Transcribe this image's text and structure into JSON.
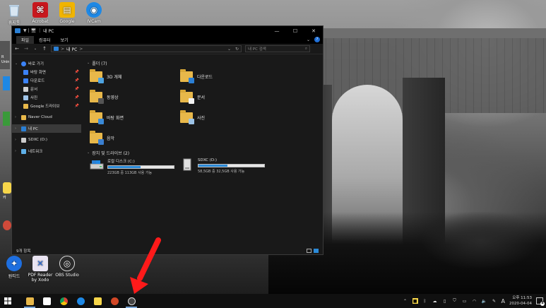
{
  "desktop": {
    "icons_top": [
      {
        "label": "휴지통",
        "icon": "recycle-bin-icon",
        "color": "#9ab7d4"
      },
      {
        "label": "Acrobat",
        "icon": "acrobat-icon",
        "color": "#c8171e"
      },
      {
        "label": "Google",
        "icon": "google-icon",
        "color": "#f0b400"
      },
      {
        "label": "IVCam",
        "icon": "ivcam-icon",
        "color": "#1e88e5"
      }
    ],
    "icons_bottom": [
      {
        "label": "원티드",
        "icon": "wanted-icon",
        "color": "#1e6fe0"
      },
      {
        "label": "PDF Reader by Xodo",
        "icon": "pdf-reader-icon",
        "color": "#e9e4f2"
      },
      {
        "label": "OBS Studio",
        "icon": "obs-icon",
        "color": "#2b2b2b"
      }
    ],
    "left_edge_fragments": [
      "R",
      "Unin",
      "카"
    ]
  },
  "window": {
    "title": "내 PC",
    "title_path_icon": "▼ | 🖥",
    "ribbon_tabs": [
      "파일",
      "컴퓨터",
      "보기"
    ],
    "address": "내 PC",
    "address_separator": ">",
    "search_placeholder": "내 PC 검색",
    "nav": [
      {
        "label": "바로 가기",
        "level": 0,
        "icon": "star-icon",
        "color": "#3b82f6"
      },
      {
        "label": "바탕 화면",
        "level": 1,
        "icon": "desktop-icon",
        "color": "#3b82f6",
        "pinned": true
      },
      {
        "label": "다운로드",
        "level": 1,
        "icon": "download-icon",
        "color": "#3b82f6",
        "pinned": true
      },
      {
        "label": "문서",
        "level": 1,
        "icon": "documents-icon",
        "color": "#d0d0d0",
        "pinned": true
      },
      {
        "label": "사진",
        "level": 1,
        "icon": "pictures-icon",
        "color": "#a0c4e8",
        "pinned": true
      },
      {
        "label": "Google 드라이브",
        "level": 1,
        "icon": "google-drive-icon",
        "color": "#e8b84a",
        "pinned": true
      },
      {
        "label": "Naver Cloud",
        "level": 0,
        "icon": "naver-cloud-icon",
        "color": "#e8b84a"
      },
      {
        "label": "내 PC",
        "level": 0,
        "icon": "this-pc-icon",
        "color": "#2a7fd4",
        "selected": true
      },
      {
        "label": "SDXC (D:)",
        "level": 0,
        "icon": "sd-card-icon",
        "color": "#cccccc"
      },
      {
        "label": "네트워크",
        "level": 0,
        "icon": "network-icon",
        "color": "#5fb0e8"
      }
    ],
    "folders_header": "폴더 (7)",
    "folders": [
      {
        "label": "3D 개체",
        "badge": "#4ea3e0"
      },
      {
        "label": "다운로드",
        "badge": "#2b7fd4"
      },
      {
        "label": "동영상",
        "badge": "#555555"
      },
      {
        "label": "문서",
        "badge": "#f2f2f2"
      },
      {
        "label": "바탕 화면",
        "badge": "#3a8ad8"
      },
      {
        "label": "사진",
        "badge": "#9cc3e6"
      },
      {
        "label": "음악",
        "badge": "#3a7fd0"
      }
    ],
    "drives_header": "장치 및 드라이브 (2)",
    "drives": [
      {
        "label": "로컬 디스크 (C:)",
        "usage": "223GB 중 113GB 사용 가능",
        "used_fraction": 0.49,
        "icon": "hard-drive-icon"
      },
      {
        "label": "SDXC (D:)",
        "usage": "58,5GB 중 32,5GB 사용 가능",
        "used_fraction": 0.44,
        "icon": "sd-drive-icon"
      }
    ],
    "status": "9개 항목"
  },
  "taskbar": {
    "apps": [
      {
        "name": "file-explorer",
        "color": "#e8b84a",
        "running": true
      },
      {
        "name": "store",
        "color": "#ffffff",
        "running": false
      },
      {
        "name": "chrome",
        "color": "#db4437",
        "running": false
      },
      {
        "name": "edge",
        "color": "#1e88e5",
        "running": false
      },
      {
        "name": "sticky-notes",
        "color": "#f7d64a",
        "running": false
      },
      {
        "name": "powerpoint",
        "color": "#d24726",
        "running": false
      },
      {
        "name": "obs",
        "color": "#444444",
        "running": true
      }
    ],
    "ime": "A",
    "time": "오후 11:53",
    "date": "2020-04-04",
    "notification_count": "4"
  },
  "colors": {
    "accent": "#2b8ad8",
    "arrow": "#ff1a1a"
  }
}
